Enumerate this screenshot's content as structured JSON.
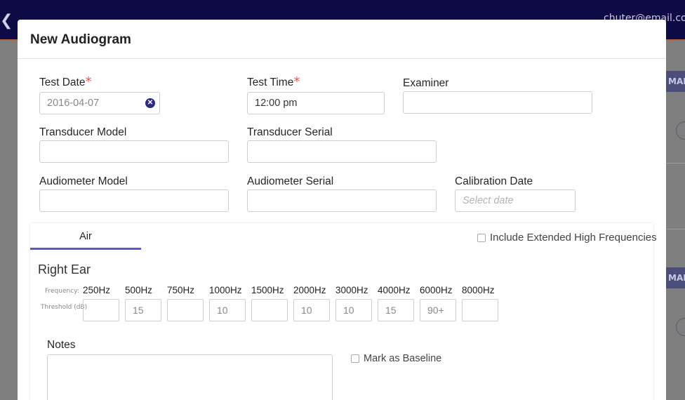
{
  "app": {
    "user_email": "chuter@email.com",
    "back_icon": "chevron-left-icon",
    "bg_tag_text": "MAR"
  },
  "modal": {
    "title": "New Audiogram",
    "fields": {
      "test_date": {
        "label": "Test Date",
        "required_mark": "*",
        "value": "2016-04-07"
      },
      "test_time": {
        "label": "Test Time",
        "required_mark": "*",
        "value": "12:00 pm"
      },
      "examiner": {
        "label": "Examiner",
        "value": ""
      },
      "transducer_model": {
        "label": "Transducer Model",
        "value": ""
      },
      "transducer_serial": {
        "label": "Transducer Serial",
        "value": ""
      },
      "audiometer_model": {
        "label": "Audiometer Model",
        "value": ""
      },
      "audiometer_serial": {
        "label": "Audiometer Serial",
        "value": ""
      },
      "calibration_date": {
        "label": "Calibration Date",
        "placeholder": "Select date",
        "value": ""
      }
    },
    "tabs": [
      {
        "label": "Air",
        "active": true
      }
    ],
    "extended_freq_label": "Include Extended High Frequencies",
    "ear_title": "Right Ear",
    "frequency_row_label": "Frequency:",
    "threshold_row_label": "Threshold (dB)",
    "frequencies": [
      "250Hz",
      "500Hz",
      "750Hz",
      "1000Hz",
      "1500Hz",
      "2000Hz",
      "3000Hz",
      "4000Hz",
      "6000Hz",
      "8000Hz"
    ],
    "thresholds": [
      "",
      "15",
      "",
      "10",
      "",
      "10",
      "10",
      "15",
      "90+",
      ""
    ],
    "notes_label": "Notes",
    "baseline_label": "Mark as Baseline"
  },
  "colors": {
    "topbar": "#0e0a45",
    "accent": "#5f54c9",
    "required": "#e25a48",
    "clear_icon": "#2a2d7d"
  }
}
